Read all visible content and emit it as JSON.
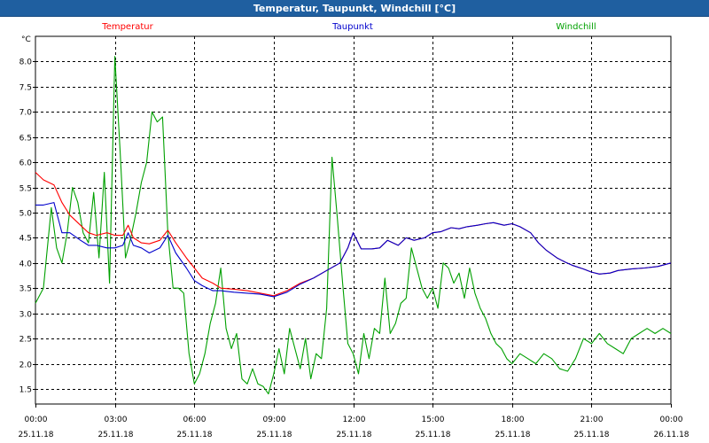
{
  "window": {
    "title": "Temperatur, Taupunkt, Windchill [°C]"
  },
  "chart_data": {
    "type": "line",
    "title": "Temperatur, Taupunkt, Windchill [°C]",
    "ylabel": "°C",
    "ylim": [
      1.2,
      8.5
    ],
    "yticks": [
      1.5,
      2.0,
      2.5,
      3.0,
      3.5,
      4.0,
      4.5,
      5.0,
      5.5,
      6.0,
      6.5,
      7.0,
      7.5,
      8.0
    ],
    "ytick_labels": [
      "1.5",
      "2.0",
      "2.5",
      "3.0",
      "3.5",
      "4.0",
      "4.5",
      "5.0",
      "5.5",
      "6.0",
      "6.5",
      "7.0",
      "7.5",
      "8.0"
    ],
    "xlim": [
      0,
      24
    ],
    "xticks": [
      {
        "t": 0,
        "time": "00:00",
        "date": "25.11.18"
      },
      {
        "t": 3,
        "time": "03:00",
        "date": "25.11.18"
      },
      {
        "t": 6,
        "time": "06:00",
        "date": "25.11.18"
      },
      {
        "t": 9,
        "time": "09:00",
        "date": "25.11.18"
      },
      {
        "t": 12,
        "time": "12:00",
        "date": "25.11.18"
      },
      {
        "t": 15,
        "time": "15:00",
        "date": "25.11.18"
      },
      {
        "t": 18,
        "time": "18:00",
        "date": "25.11.18"
      },
      {
        "t": 21,
        "time": "21:00",
        "date": "25.11.18"
      },
      {
        "t": 24,
        "time": "00:00",
        "date": "26.11.18"
      }
    ],
    "grid": true,
    "legend_position": "top",
    "series": [
      {
        "name": "Temperatur",
        "color": "#ff0000",
        "x": [
          0,
          0.3,
          0.7,
          1.0,
          1.3,
          1.7,
          2.0,
          2.3,
          2.7,
          3.0,
          3.3,
          3.5,
          3.7,
          4.0,
          4.3,
          4.7,
          5.0,
          5.3,
          5.7,
          6.0,
          6.3,
          6.7,
          7.0,
          7.5,
          8.0,
          8.5,
          9.0,
          9.5,
          10.0,
          10.5,
          11.0,
          11.5,
          11.8,
          12.0,
          12.3,
          12.7,
          13.0,
          13.3,
          13.7,
          14.0,
          14.3,
          14.7,
          15.0,
          15.3,
          15.7,
          16.0,
          16.3,
          16.7,
          17.0,
          17.3,
          17.7,
          18.0,
          18.3,
          18.7,
          19.0,
          19.3,
          19.7,
          20.0,
          20.3,
          20.7,
          21.0,
          21.3,
          21.7,
          22.0,
          22.5,
          23.0,
          23.5,
          24.0
        ],
        "values": [
          5.8,
          5.65,
          5.55,
          5.2,
          4.95,
          4.75,
          4.6,
          4.55,
          4.6,
          4.55,
          4.55,
          4.75,
          4.5,
          4.4,
          4.38,
          4.45,
          4.65,
          4.4,
          4.1,
          3.9,
          3.7,
          3.6,
          3.5,
          3.48,
          3.45,
          3.4,
          3.35,
          3.45,
          3.6,
          3.7,
          3.85,
          4.0,
          4.3,
          4.6,
          4.28,
          4.28,
          4.3,
          4.45,
          4.35,
          4.5,
          4.45,
          4.5,
          4.6,
          4.62,
          4.7,
          4.68,
          4.72,
          4.75,
          4.78,
          4.8,
          4.75,
          4.78,
          4.72,
          4.6,
          4.4,
          4.25,
          4.1,
          4.02,
          3.95,
          3.88,
          3.82,
          3.78,
          3.8,
          3.85,
          3.88,
          3.9,
          3.93,
          4.0
        ]
      },
      {
        "name": "Taupunkt",
        "color": "#0000cc",
        "x": [
          0,
          0.3,
          0.7,
          1.0,
          1.3,
          1.7,
          2.0,
          2.3,
          2.7,
          3.0,
          3.3,
          3.5,
          3.7,
          4.0,
          4.3,
          4.7,
          5.0,
          5.3,
          5.7,
          6.0,
          6.3,
          6.7,
          7.0,
          7.5,
          8.0,
          8.5,
          9.0,
          9.5,
          10.0,
          10.5,
          11.0,
          11.5,
          11.8,
          12.0,
          12.3,
          12.7,
          13.0,
          13.3,
          13.7,
          14.0,
          14.3,
          14.7,
          15.0,
          15.3,
          15.7,
          16.0,
          16.3,
          16.7,
          17.0,
          17.3,
          17.7,
          18.0,
          18.3,
          18.7,
          19.0,
          19.3,
          19.7,
          20.0,
          20.3,
          20.7,
          21.0,
          21.3,
          21.7,
          22.0,
          22.5,
          23.0,
          23.5,
          24.0
        ],
        "values": [
          5.15,
          5.15,
          5.2,
          4.6,
          4.6,
          4.45,
          4.35,
          4.35,
          4.3,
          4.3,
          4.35,
          4.6,
          4.35,
          4.3,
          4.2,
          4.3,
          4.55,
          4.2,
          3.9,
          3.65,
          3.55,
          3.45,
          3.45,
          3.42,
          3.4,
          3.38,
          3.33,
          3.42,
          3.58,
          3.7,
          3.85,
          4.0,
          4.3,
          4.6,
          4.28,
          4.28,
          4.3,
          4.45,
          4.35,
          4.5,
          4.45,
          4.5,
          4.6,
          4.62,
          4.7,
          4.68,
          4.72,
          4.75,
          4.78,
          4.8,
          4.75,
          4.78,
          4.72,
          4.6,
          4.4,
          4.25,
          4.1,
          4.02,
          3.95,
          3.88,
          3.82,
          3.78,
          3.8,
          3.85,
          3.88,
          3.9,
          3.93,
          4.0
        ]
      },
      {
        "name": "Windchill",
        "color": "#00a000",
        "x": [
          0,
          0.3,
          0.6,
          0.8,
          1.0,
          1.2,
          1.4,
          1.6,
          1.8,
          2.0,
          2.2,
          2.4,
          2.6,
          2.8,
          3.0,
          3.2,
          3.4,
          3.6,
          3.8,
          4.0,
          4.2,
          4.4,
          4.6,
          4.8,
          5.0,
          5.2,
          5.4,
          5.6,
          5.8,
          6.0,
          6.2,
          6.4,
          6.6,
          6.8,
          7.0,
          7.2,
          7.4,
          7.6,
          7.8,
          8.0,
          8.2,
          8.4,
          8.6,
          8.8,
          9.0,
          9.2,
          9.4,
          9.6,
          9.8,
          10.0,
          10.2,
          10.4,
          10.6,
          10.8,
          11.0,
          11.2,
          11.4,
          11.6,
          11.8,
          12.0,
          12.2,
          12.4,
          12.6,
          12.8,
          13.0,
          13.2,
          13.4,
          13.6,
          13.8,
          14.0,
          14.2,
          14.4,
          14.6,
          14.8,
          15.0,
          15.2,
          15.4,
          15.6,
          15.8,
          16.0,
          16.2,
          16.4,
          16.6,
          16.8,
          17.0,
          17.2,
          17.4,
          17.6,
          17.8,
          18.0,
          18.3,
          18.6,
          18.9,
          19.2,
          19.5,
          19.8,
          20.1,
          20.4,
          20.7,
          21.0,
          21.3,
          21.6,
          21.9,
          22.2,
          22.5,
          22.8,
          23.1,
          23.4,
          23.7,
          24.0
        ],
        "values": [
          3.2,
          3.5,
          5.1,
          4.3,
          4.0,
          4.6,
          5.5,
          5.2,
          4.6,
          4.4,
          5.4,
          4.1,
          5.8,
          3.6,
          8.1,
          6.2,
          4.1,
          4.5,
          5.0,
          5.6,
          6.0,
          7.0,
          6.8,
          6.9,
          4.6,
          3.5,
          3.5,
          3.4,
          2.2,
          1.6,
          1.8,
          2.2,
          2.8,
          3.2,
          3.9,
          2.7,
          2.3,
          2.6,
          1.7,
          1.6,
          1.9,
          1.6,
          1.55,
          1.4,
          1.8,
          2.3,
          1.8,
          2.7,
          2.3,
          1.9,
          2.5,
          1.7,
          2.2,
          2.1,
          3.1,
          6.1,
          4.9,
          3.6,
          2.4,
          2.2,
          1.8,
          2.6,
          2.1,
          2.7,
          2.6,
          3.7,
          2.6,
          2.8,
          3.2,
          3.3,
          4.3,
          3.9,
          3.5,
          3.3,
          3.5,
          3.1,
          4.0,
          3.9,
          3.6,
          3.8,
          3.3,
          3.9,
          3.4,
          3.1,
          2.9,
          2.6,
          2.4,
          2.3,
          2.1,
          2.0,
          2.2,
          2.1,
          2.0,
          2.2,
          2.1,
          1.9,
          1.85,
          2.1,
          2.5,
          2.4,
          2.6,
          2.4,
          2.3,
          2.2,
          2.5,
          2.6,
          2.7,
          2.6,
          2.7,
          2.6
        ]
      }
    ]
  }
}
